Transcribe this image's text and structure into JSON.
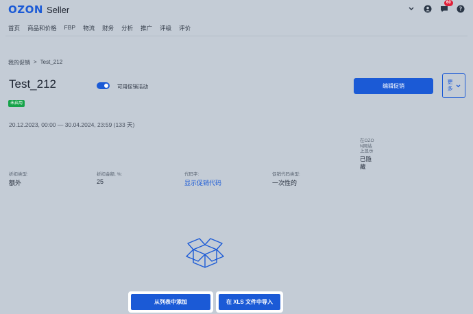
{
  "header": {
    "logo_brand": "OZON",
    "logo_product": "Seller",
    "notification_count": "60"
  },
  "nav": {
    "items": [
      "首页",
      "商品和价格",
      "FBP",
      "物流",
      "财务",
      "分析",
      "推广",
      "评级",
      "评价"
    ]
  },
  "breadcrumb": {
    "parent": "我的促销",
    "separator": ">",
    "current": "Test_212"
  },
  "promo": {
    "title": "Test_212",
    "toggle_label": "可用促销活动",
    "toggle_on": true,
    "status": "未启用",
    "date_range": "20.12.2023, 00:00 — 30.04.2024, 23:59 (133 天)",
    "edit_button": "编辑促销",
    "more_button": "更多"
  },
  "details": {
    "discount_type_label": "折扣类型:",
    "discount_type_value": "额外",
    "discount_amount_label": "折扣金额, %:",
    "discount_amount_value": "25",
    "promo_code_label": "代码字:",
    "promo_code_value": "显示促销代码",
    "code_type_label": "促销代码类型:",
    "code_type_value": "一次性的",
    "visibility_label": "在OZON网站上显示",
    "visibility_value": "已隐藏"
  },
  "actions": {
    "add_from_list": "从列表中添加",
    "import_xls": "在 XLS 文件中导入"
  },
  "colors": {
    "accent": "#1b5ad6",
    "background": "#c4ccd6",
    "status_green": "#16a34a",
    "badge_red": "#e0203a"
  }
}
